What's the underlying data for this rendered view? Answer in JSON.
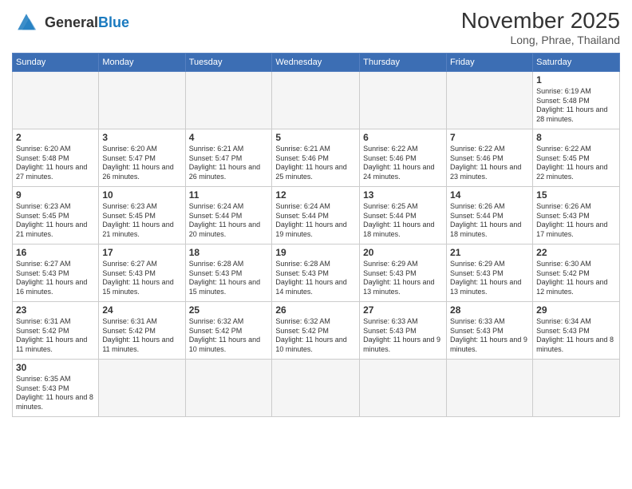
{
  "header": {
    "logo_general": "General",
    "logo_blue": "Blue",
    "month_title": "November 2025",
    "location": "Long, Phrae, Thailand"
  },
  "days_of_week": [
    "Sunday",
    "Monday",
    "Tuesday",
    "Wednesday",
    "Thursday",
    "Friday",
    "Saturday"
  ],
  "weeks": [
    [
      {
        "day": "",
        "info": ""
      },
      {
        "day": "",
        "info": ""
      },
      {
        "day": "",
        "info": ""
      },
      {
        "day": "",
        "info": ""
      },
      {
        "day": "",
        "info": ""
      },
      {
        "day": "",
        "info": ""
      },
      {
        "day": "1",
        "info": "Sunrise: 6:19 AM\nSunset: 5:48 PM\nDaylight: 11 hours\nand 28 minutes."
      }
    ],
    [
      {
        "day": "2",
        "info": "Sunrise: 6:20 AM\nSunset: 5:48 PM\nDaylight: 11 hours\nand 27 minutes."
      },
      {
        "day": "3",
        "info": "Sunrise: 6:20 AM\nSunset: 5:47 PM\nDaylight: 11 hours\nand 26 minutes."
      },
      {
        "day": "4",
        "info": "Sunrise: 6:21 AM\nSunset: 5:47 PM\nDaylight: 11 hours\nand 26 minutes."
      },
      {
        "day": "5",
        "info": "Sunrise: 6:21 AM\nSunset: 5:46 PM\nDaylight: 11 hours\nand 25 minutes."
      },
      {
        "day": "6",
        "info": "Sunrise: 6:22 AM\nSunset: 5:46 PM\nDaylight: 11 hours\nand 24 minutes."
      },
      {
        "day": "7",
        "info": "Sunrise: 6:22 AM\nSunset: 5:46 PM\nDaylight: 11 hours\nand 23 minutes."
      },
      {
        "day": "8",
        "info": "Sunrise: 6:22 AM\nSunset: 5:45 PM\nDaylight: 11 hours\nand 22 minutes."
      }
    ],
    [
      {
        "day": "9",
        "info": "Sunrise: 6:23 AM\nSunset: 5:45 PM\nDaylight: 11 hours\nand 21 minutes."
      },
      {
        "day": "10",
        "info": "Sunrise: 6:23 AM\nSunset: 5:45 PM\nDaylight: 11 hours\nand 21 minutes."
      },
      {
        "day": "11",
        "info": "Sunrise: 6:24 AM\nSunset: 5:44 PM\nDaylight: 11 hours\nand 20 minutes."
      },
      {
        "day": "12",
        "info": "Sunrise: 6:24 AM\nSunset: 5:44 PM\nDaylight: 11 hours\nand 19 minutes."
      },
      {
        "day": "13",
        "info": "Sunrise: 6:25 AM\nSunset: 5:44 PM\nDaylight: 11 hours\nand 18 minutes."
      },
      {
        "day": "14",
        "info": "Sunrise: 6:26 AM\nSunset: 5:44 PM\nDaylight: 11 hours\nand 18 minutes."
      },
      {
        "day": "15",
        "info": "Sunrise: 6:26 AM\nSunset: 5:43 PM\nDaylight: 11 hours\nand 17 minutes."
      }
    ],
    [
      {
        "day": "16",
        "info": "Sunrise: 6:27 AM\nSunset: 5:43 PM\nDaylight: 11 hours\nand 16 minutes."
      },
      {
        "day": "17",
        "info": "Sunrise: 6:27 AM\nSunset: 5:43 PM\nDaylight: 11 hours\nand 15 minutes."
      },
      {
        "day": "18",
        "info": "Sunrise: 6:28 AM\nSunset: 5:43 PM\nDaylight: 11 hours\nand 15 minutes."
      },
      {
        "day": "19",
        "info": "Sunrise: 6:28 AM\nSunset: 5:43 PM\nDaylight: 11 hours\nand 14 minutes."
      },
      {
        "day": "20",
        "info": "Sunrise: 6:29 AM\nSunset: 5:43 PM\nDaylight: 11 hours\nand 13 minutes."
      },
      {
        "day": "21",
        "info": "Sunrise: 6:29 AM\nSunset: 5:43 PM\nDaylight: 11 hours\nand 13 minutes."
      },
      {
        "day": "22",
        "info": "Sunrise: 6:30 AM\nSunset: 5:42 PM\nDaylight: 11 hours\nand 12 minutes."
      }
    ],
    [
      {
        "day": "23",
        "info": "Sunrise: 6:31 AM\nSunset: 5:42 PM\nDaylight: 11 hours\nand 11 minutes."
      },
      {
        "day": "24",
        "info": "Sunrise: 6:31 AM\nSunset: 5:42 PM\nDaylight: 11 hours\nand 11 minutes."
      },
      {
        "day": "25",
        "info": "Sunrise: 6:32 AM\nSunset: 5:42 PM\nDaylight: 11 hours\nand 10 minutes."
      },
      {
        "day": "26",
        "info": "Sunrise: 6:32 AM\nSunset: 5:42 PM\nDaylight: 11 hours\nand 10 minutes."
      },
      {
        "day": "27",
        "info": "Sunrise: 6:33 AM\nSunset: 5:43 PM\nDaylight: 11 hours\nand 9 minutes."
      },
      {
        "day": "28",
        "info": "Sunrise: 6:33 AM\nSunset: 5:43 PM\nDaylight: 11 hours\nand 9 minutes."
      },
      {
        "day": "29",
        "info": "Sunrise: 6:34 AM\nSunset: 5:43 PM\nDaylight: 11 hours\nand 8 minutes."
      }
    ],
    [
      {
        "day": "30",
        "info": "Sunrise: 6:35 AM\nSunset: 5:43 PM\nDaylight: 11 hours\nand 8 minutes."
      },
      {
        "day": "",
        "info": ""
      },
      {
        "day": "",
        "info": ""
      },
      {
        "day": "",
        "info": ""
      },
      {
        "day": "",
        "info": ""
      },
      {
        "day": "",
        "info": ""
      },
      {
        "day": "",
        "info": ""
      }
    ]
  ]
}
